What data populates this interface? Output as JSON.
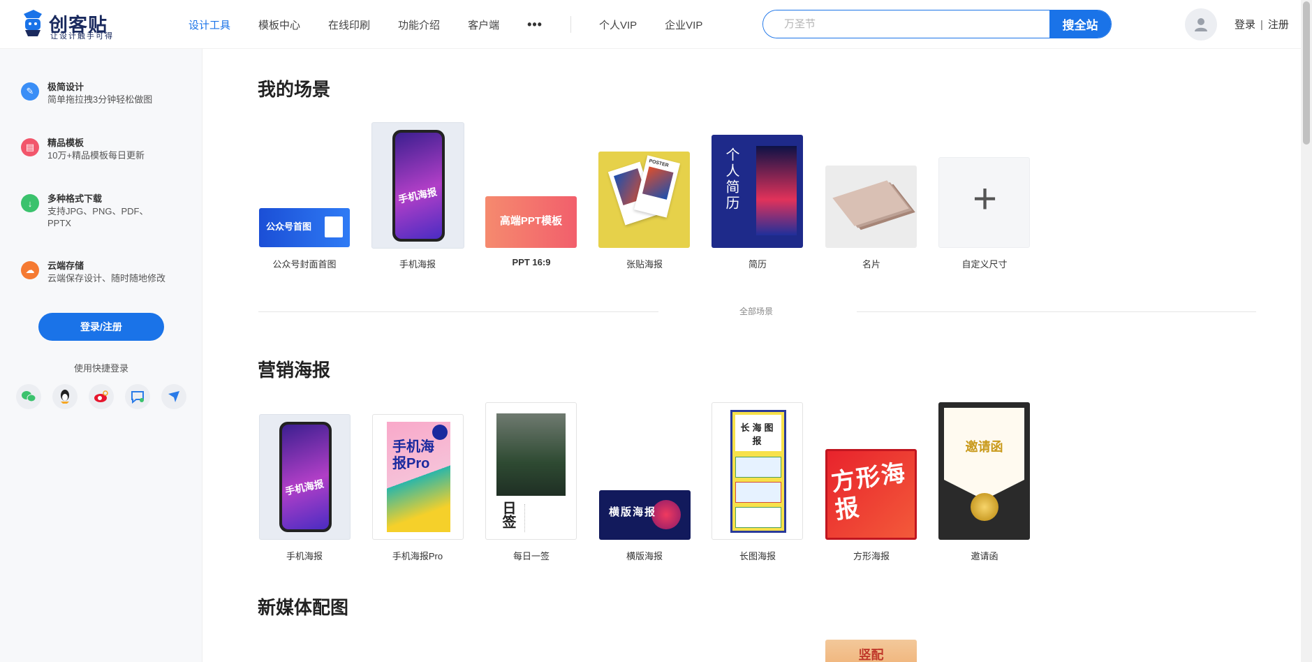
{
  "brand": {
    "name": "创客贴",
    "slogan": "让设计触手可得"
  },
  "nav": {
    "items": [
      "设计工具",
      "模板中心",
      "在线印刷",
      "功能介绍",
      "客户端"
    ],
    "more": "•••",
    "vip": [
      "个人VIP",
      "企业VIP"
    ]
  },
  "search": {
    "placeholder": "万圣节",
    "button": "搜全站"
  },
  "auth": {
    "login": "登录",
    "sep": "|",
    "register": "注册"
  },
  "sidebar": {
    "features": [
      {
        "title": "极简设计",
        "desc": "简单拖拉拽3分钟轻松做图",
        "color": "#3a8ef6",
        "icon": "pencil-icon"
      },
      {
        "title": "精品模板",
        "desc": "10万+精品模板每日更新",
        "color": "#f2566b",
        "icon": "template-icon"
      },
      {
        "title": "多种格式下载",
        "desc": "支持JPG、PNG、PDF、PPTX",
        "color": "#3bc26d",
        "icon": "download-icon"
      },
      {
        "title": "云端存储",
        "desc": "云端保存设计、随时随地修改",
        "color": "#f57a32",
        "icon": "cloud-icon"
      }
    ],
    "login_button": "登录/注册",
    "quick_login": "使用快捷登录",
    "social": [
      "wechat-icon",
      "qq-icon",
      "weibo-icon",
      "dingtalk-icon",
      "feishu-icon"
    ]
  },
  "sections": {
    "my_scenes": {
      "title": "我的场景",
      "items": [
        {
          "label": "公众号封面首图",
          "thumb_text": "公众号首图"
        },
        {
          "label": "手机海报",
          "thumb_text": "手机海报"
        },
        {
          "label": "PPT 16:9",
          "thumb_text": "高端PPT模板"
        },
        {
          "label": "张贴海报",
          "thumb_text": "POSTER"
        },
        {
          "label": "简历",
          "thumb_text": "个人简历"
        },
        {
          "label": "名片",
          "thumb_text": ""
        },
        {
          "label": "自定义尺寸",
          "thumb_text": "+"
        }
      ],
      "all_link": "全部场景"
    },
    "marketing": {
      "title": "营销海报",
      "items": [
        {
          "label": "手机海报",
          "thumb_text": "手机海报"
        },
        {
          "label": "手机海报Pro",
          "thumb_text": "手机海报Pro"
        },
        {
          "label": "每日一签",
          "thumb_text": "日签"
        },
        {
          "label": "横版海报",
          "thumb_text": "横版海报"
        },
        {
          "label": "长图海报",
          "thumb_text": "长海图报"
        },
        {
          "label": "方形海报",
          "thumb_text": "方形海报"
        },
        {
          "label": "邀请函",
          "thumb_text": "邀请函"
        }
      ]
    },
    "new_media": {
      "title": "新媒体配图",
      "peek_text": "竖配"
    }
  },
  "colors": {
    "accent": "#1a73e8"
  }
}
